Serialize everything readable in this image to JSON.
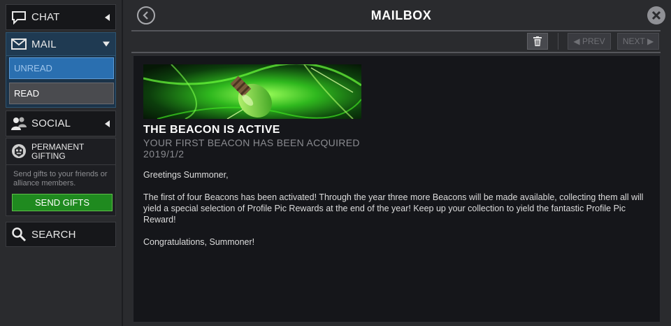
{
  "sidebar": {
    "chat": {
      "label": "CHAT",
      "icon": "speech-bubble-icon"
    },
    "mail": {
      "label": "MAIL",
      "icon": "envelope-icon",
      "sub_items": [
        {
          "label": "UNREAD",
          "selected": true
        },
        {
          "label": "READ",
          "selected": false
        }
      ]
    },
    "social": {
      "label": "SOCIAL",
      "icon": "people-icon"
    },
    "gifting": {
      "title_line1": "PERMANENT",
      "title_line2": "GIFTING",
      "icon": "gift-emblem-icon",
      "description": "Send gifts to your friends or alliance members.",
      "button_label": "SEND GIFTS"
    },
    "search": {
      "label": "SEARCH",
      "icon": "magnifier-icon"
    }
  },
  "header": {
    "title": "MAILBOX"
  },
  "toolbar": {
    "prev_label": "PREV",
    "next_label": "NEXT"
  },
  "message": {
    "title": "THE BEACON IS ACTIVE",
    "subtitle": "YOUR FIRST BEACON HAS BEEN ACQUIRED",
    "date": "2019/1/2",
    "greeting": "Greetings Summoner,",
    "body": "The first of four Beacons has been activated! Through the year three more Beacons will be made available, collecting them all will yield a special selection of Profile Pic Rewards at the end of the year! Keep up your collection to yield the fantastic Profile Pic Reward!",
    "closing": "Congratulations, Summoner!"
  },
  "colors": {
    "send_gifts_green": "#1f8a1f",
    "unread_blue": "#2a6fb0",
    "banner_green": "#3ddc2a"
  }
}
